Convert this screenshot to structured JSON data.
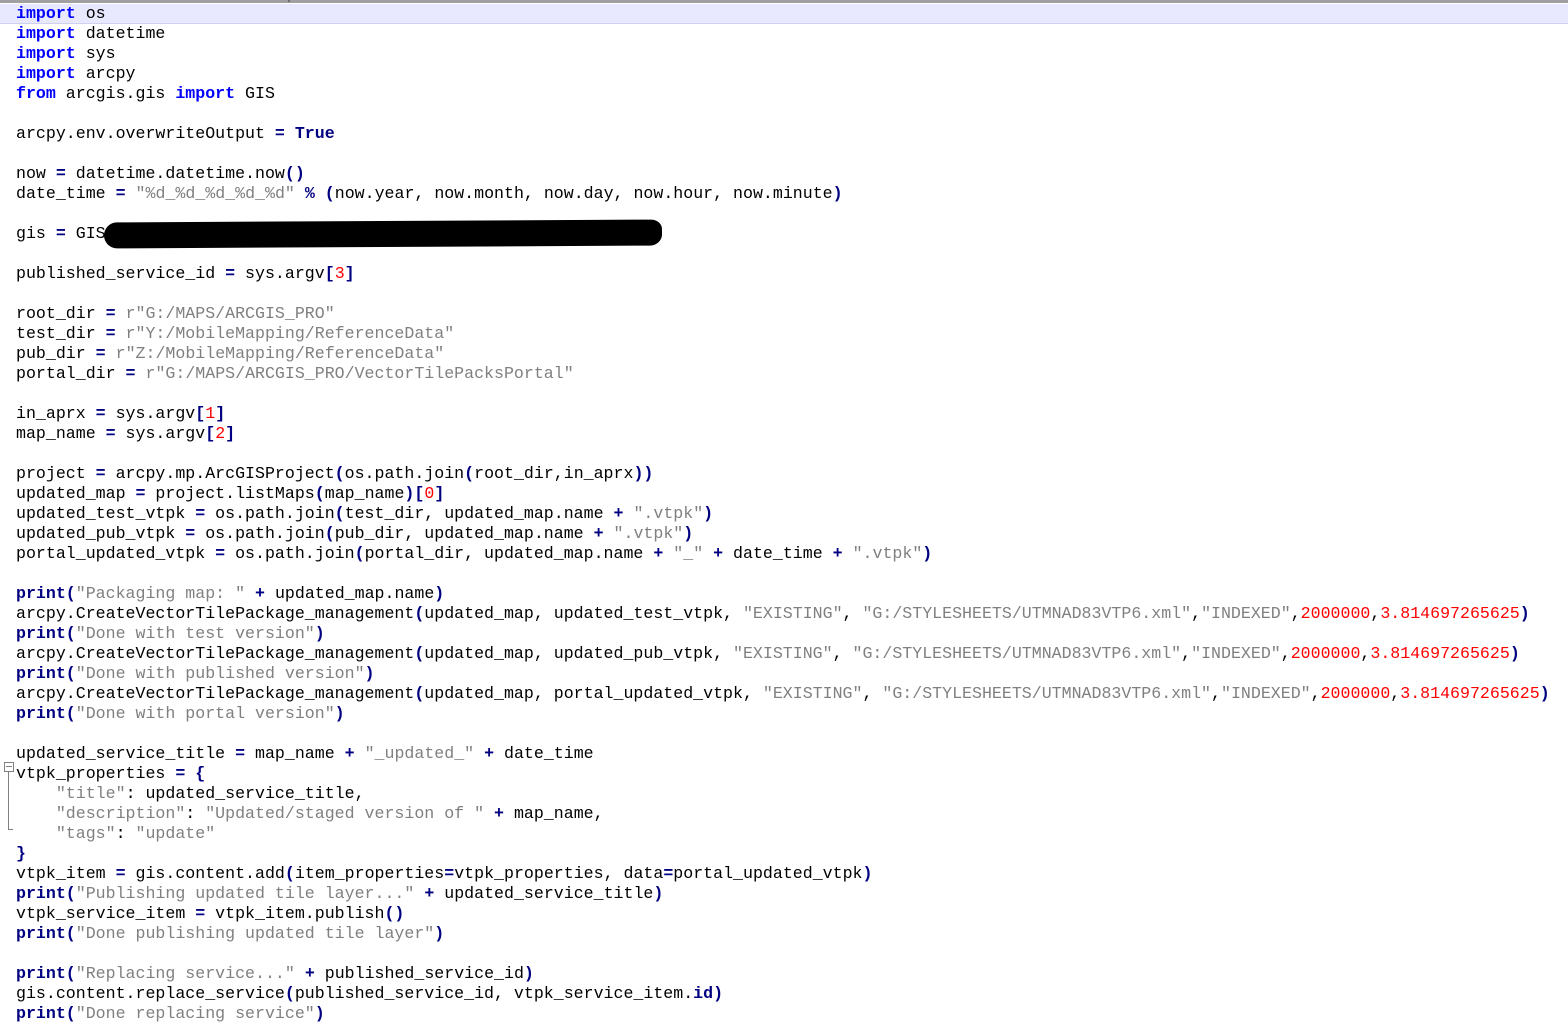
{
  "editor": {
    "language": "Python",
    "current_line": 0,
    "lines": [
      [
        [
          "kw",
          "import"
        ],
        [
          "p",
          " os"
        ]
      ],
      [
        [
          "kw",
          "import"
        ],
        [
          "p",
          " datetime"
        ]
      ],
      [
        [
          "kw",
          "import"
        ],
        [
          "p",
          " sys"
        ]
      ],
      [
        [
          "kw",
          "import"
        ],
        [
          "p",
          " arcpy"
        ]
      ],
      [
        [
          "kw",
          "from"
        ],
        [
          "p",
          " arcgis.gis "
        ],
        [
          "kw",
          "import"
        ],
        [
          "p",
          " GIS"
        ]
      ],
      [],
      [
        [
          "p",
          "arcpy.env.overwriteOutput "
        ],
        [
          "op",
          "="
        ],
        [
          "p",
          " "
        ],
        [
          "kw2",
          "True"
        ]
      ],
      [],
      [
        [
          "p",
          "now "
        ],
        [
          "op",
          "="
        ],
        [
          "p",
          " datetime.datetime.now"
        ],
        [
          "paren",
          "()"
        ]
      ],
      [
        [
          "p",
          "date_time "
        ],
        [
          "op",
          "="
        ],
        [
          "p",
          " "
        ],
        [
          "str",
          "\"%d_%d_%d_%d_%d\""
        ],
        [
          "p",
          " "
        ],
        [
          "op",
          "%"
        ],
        [
          "p",
          " "
        ],
        [
          "paren",
          "("
        ],
        [
          "p",
          "now.year, now.month, now.day, now.hour, now.minute"
        ],
        [
          "paren",
          ")"
        ]
      ],
      [],
      [
        [
          "p",
          "gis "
        ],
        [
          "op",
          "="
        ],
        [
          "p",
          " GIS"
        ]
      ],
      [],
      [
        [
          "p",
          "published_service_id "
        ],
        [
          "op",
          "="
        ],
        [
          "p",
          " sys.argv"
        ],
        [
          "paren",
          "["
        ],
        [
          "num",
          "3"
        ],
        [
          "paren",
          "]"
        ]
      ],
      [],
      [
        [
          "p",
          "root_dir "
        ],
        [
          "op",
          "="
        ],
        [
          "p",
          " "
        ],
        [
          "str",
          "r\"G:/MAPS/ARCGIS_PRO\""
        ]
      ],
      [
        [
          "p",
          "test_dir "
        ],
        [
          "op",
          "="
        ],
        [
          "p",
          " "
        ],
        [
          "str",
          "r\"Y:/MobileMapping/ReferenceData\""
        ]
      ],
      [
        [
          "p",
          "pub_dir "
        ],
        [
          "op",
          "="
        ],
        [
          "p",
          " "
        ],
        [
          "str",
          "r\"Z:/MobileMapping/ReferenceData\""
        ]
      ],
      [
        [
          "p",
          "portal_dir "
        ],
        [
          "op",
          "="
        ],
        [
          "p",
          " "
        ],
        [
          "str",
          "r\"G:/MAPS/ARCGIS_PRO/VectorTilePacksPortal\""
        ]
      ],
      [],
      [
        [
          "p",
          "in_aprx "
        ],
        [
          "op",
          "="
        ],
        [
          "p",
          " sys.argv"
        ],
        [
          "paren",
          "["
        ],
        [
          "num",
          "1"
        ],
        [
          "paren",
          "]"
        ]
      ],
      [
        [
          "p",
          "map_name "
        ],
        [
          "op",
          "="
        ],
        [
          "p",
          " sys.argv"
        ],
        [
          "paren",
          "["
        ],
        [
          "num",
          "2"
        ],
        [
          "paren",
          "]"
        ]
      ],
      [],
      [
        [
          "p",
          "project "
        ],
        [
          "op",
          "="
        ],
        [
          "p",
          " arcpy.mp.ArcGISProject"
        ],
        [
          "paren",
          "("
        ],
        [
          "p",
          "os.path.join"
        ],
        [
          "paren",
          "("
        ],
        [
          "p",
          "root_dir,in_aprx"
        ],
        [
          "paren",
          "))"
        ]
      ],
      [
        [
          "p",
          "updated_map "
        ],
        [
          "op",
          "="
        ],
        [
          "p",
          " project.listMaps"
        ],
        [
          "paren",
          "("
        ],
        [
          "p",
          "map_name"
        ],
        [
          "paren",
          ")"
        ],
        [
          "paren",
          "["
        ],
        [
          "num",
          "0"
        ],
        [
          "paren",
          "]"
        ]
      ],
      [
        [
          "p",
          "updated_test_vtpk "
        ],
        [
          "op",
          "="
        ],
        [
          "p",
          " os.path.join"
        ],
        [
          "paren",
          "("
        ],
        [
          "p",
          "test_dir, updated_map.name "
        ],
        [
          "op",
          "+"
        ],
        [
          "p",
          " "
        ],
        [
          "str",
          "\".vtpk\""
        ],
        [
          "paren",
          ")"
        ]
      ],
      [
        [
          "p",
          "updated_pub_vtpk "
        ],
        [
          "op",
          "="
        ],
        [
          "p",
          " os.path.join"
        ],
        [
          "paren",
          "("
        ],
        [
          "p",
          "pub_dir, updated_map.name "
        ],
        [
          "op",
          "+"
        ],
        [
          "p",
          " "
        ],
        [
          "str",
          "\".vtpk\""
        ],
        [
          "paren",
          ")"
        ]
      ],
      [
        [
          "p",
          "portal_updated_vtpk "
        ],
        [
          "op",
          "="
        ],
        [
          "p",
          " os.path.join"
        ],
        [
          "paren",
          "("
        ],
        [
          "p",
          "portal_dir, updated_map.name "
        ],
        [
          "op",
          "+"
        ],
        [
          "p",
          " "
        ],
        [
          "str",
          "\"_\""
        ],
        [
          "p",
          " "
        ],
        [
          "op",
          "+"
        ],
        [
          "p",
          " date_time "
        ],
        [
          "op",
          "+"
        ],
        [
          "p",
          " "
        ],
        [
          "str",
          "\".vtpk\""
        ],
        [
          "paren",
          ")"
        ]
      ],
      [],
      [
        [
          "kw2",
          "print"
        ],
        [
          "paren",
          "("
        ],
        [
          "str",
          "\"Packaging map: \""
        ],
        [
          "p",
          " "
        ],
        [
          "op",
          "+"
        ],
        [
          "p",
          " updated_map.name"
        ],
        [
          "paren",
          ")"
        ]
      ],
      [
        [
          "p",
          "arcpy.CreateVectorTilePackage_management"
        ],
        [
          "paren",
          "("
        ],
        [
          "p",
          "updated_map, updated_test_vtpk, "
        ],
        [
          "str",
          "\"EXISTING\""
        ],
        [
          "p",
          ", "
        ],
        [
          "str",
          "\"G:/STYLESHEETS/UTMNAD83VTP6.xml\""
        ],
        [
          "p",
          ","
        ],
        [
          "str",
          "\"INDEXED\""
        ],
        [
          "p",
          ","
        ],
        [
          "num",
          "2000000"
        ],
        [
          "p",
          ","
        ],
        [
          "num",
          "3.814697265625"
        ],
        [
          "paren",
          ")"
        ]
      ],
      [
        [
          "kw2",
          "print"
        ],
        [
          "paren",
          "("
        ],
        [
          "str",
          "\"Done with test version\""
        ],
        [
          "paren",
          ")"
        ]
      ],
      [
        [
          "p",
          "arcpy.CreateVectorTilePackage_management"
        ],
        [
          "paren",
          "("
        ],
        [
          "p",
          "updated_map, updated_pub_vtpk, "
        ],
        [
          "str",
          "\"EXISTING\""
        ],
        [
          "p",
          ", "
        ],
        [
          "str",
          "\"G:/STYLESHEETS/UTMNAD83VTP6.xml\""
        ],
        [
          "p",
          ","
        ],
        [
          "str",
          "\"INDEXED\""
        ],
        [
          "p",
          ","
        ],
        [
          "num",
          "2000000"
        ],
        [
          "p",
          ","
        ],
        [
          "num",
          "3.814697265625"
        ],
        [
          "paren",
          ")"
        ]
      ],
      [
        [
          "kw2",
          "print"
        ],
        [
          "paren",
          "("
        ],
        [
          "str",
          "\"Done with published version\""
        ],
        [
          "paren",
          ")"
        ]
      ],
      [
        [
          "p",
          "arcpy.CreateVectorTilePackage_management"
        ],
        [
          "paren",
          "("
        ],
        [
          "p",
          "updated_map, portal_updated_vtpk, "
        ],
        [
          "str",
          "\"EXISTING\""
        ],
        [
          "p",
          ", "
        ],
        [
          "str",
          "\"G:/STYLESHEETS/UTMNAD83VTP6.xml\""
        ],
        [
          "p",
          ","
        ],
        [
          "str",
          "\"INDEXED\""
        ],
        [
          "p",
          ","
        ],
        [
          "num",
          "2000000"
        ],
        [
          "p",
          ","
        ],
        [
          "num",
          "3.814697265625"
        ],
        [
          "paren",
          ")"
        ]
      ],
      [
        [
          "kw2",
          "print"
        ],
        [
          "paren",
          "("
        ],
        [
          "str",
          "\"Done with portal version\""
        ],
        [
          "paren",
          ")"
        ]
      ],
      [],
      [
        [
          "p",
          "updated_service_title "
        ],
        [
          "op",
          "="
        ],
        [
          "p",
          " map_name "
        ],
        [
          "op",
          "+"
        ],
        [
          "p",
          " "
        ],
        [
          "str",
          "\"_updated_\""
        ],
        [
          "p",
          " "
        ],
        [
          "op",
          "+"
        ],
        [
          "p",
          " date_time"
        ]
      ],
      [
        [
          "p",
          "vtpk_properties "
        ],
        [
          "op",
          "="
        ],
        [
          "p",
          " "
        ],
        [
          "paren",
          "{"
        ]
      ],
      [
        [
          "p",
          "    "
        ],
        [
          "str",
          "\"title\""
        ],
        [
          "p",
          ": updated_service_title,"
        ]
      ],
      [
        [
          "p",
          "    "
        ],
        [
          "str",
          "\"description\""
        ],
        [
          "p",
          ": "
        ],
        [
          "str",
          "\"Updated/staged version of \""
        ],
        [
          "p",
          " "
        ],
        [
          "op",
          "+"
        ],
        [
          "p",
          " map_name,"
        ]
      ],
      [
        [
          "p",
          "    "
        ],
        [
          "str",
          "\"tags\""
        ],
        [
          "p",
          ": "
        ],
        [
          "str",
          "\"update\""
        ]
      ],
      [
        [
          "paren",
          "}"
        ]
      ],
      [
        [
          "p",
          "vtpk_item "
        ],
        [
          "op",
          "="
        ],
        [
          "p",
          " gis.content.add"
        ],
        [
          "paren",
          "("
        ],
        [
          "p",
          "item_properties"
        ],
        [
          "op",
          "="
        ],
        [
          "p",
          "vtpk_properties, data"
        ],
        [
          "op",
          "="
        ],
        [
          "p",
          "portal_updated_vtpk"
        ],
        [
          "paren",
          ")"
        ]
      ],
      [
        [
          "kw2",
          "print"
        ],
        [
          "paren",
          "("
        ],
        [
          "str",
          "\"Publishing updated tile layer...\""
        ],
        [
          "p",
          " "
        ],
        [
          "op",
          "+"
        ],
        [
          "p",
          " updated_service_title"
        ],
        [
          "paren",
          ")"
        ]
      ],
      [
        [
          "p",
          "vtpk_service_item "
        ],
        [
          "op",
          "="
        ],
        [
          "p",
          " vtpk_item.publish"
        ],
        [
          "paren",
          "()"
        ]
      ],
      [
        [
          "kw2",
          "print"
        ],
        [
          "paren",
          "("
        ],
        [
          "str",
          "\"Done publishing updated tile layer\""
        ],
        [
          "paren",
          ")"
        ]
      ],
      [],
      [
        [
          "kw2",
          "print"
        ],
        [
          "paren",
          "("
        ],
        [
          "str",
          "\"Replacing service...\""
        ],
        [
          "p",
          " "
        ],
        [
          "op",
          "+"
        ],
        [
          "p",
          " published_service_id"
        ],
        [
          "paren",
          ")"
        ]
      ],
      [
        [
          "p",
          "gis.content.replace_service"
        ],
        [
          "paren",
          "("
        ],
        [
          "p",
          "published_service_id, vtpk_service_item."
        ],
        [
          "kw2",
          "id"
        ],
        [
          "paren",
          ")"
        ]
      ],
      [
        [
          "kw2",
          "print"
        ],
        [
          "paren",
          "("
        ],
        [
          "str",
          "\"Done replacing service\""
        ],
        [
          "paren",
          ")"
        ]
      ]
    ]
  }
}
